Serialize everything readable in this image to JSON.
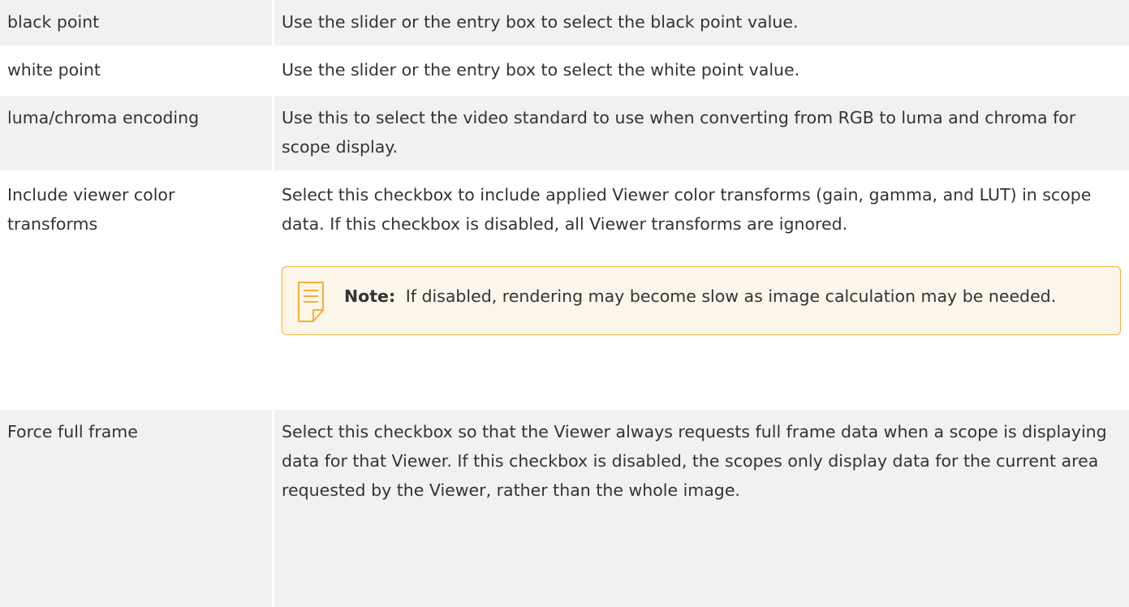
{
  "rows": [
    {
      "label": "black point",
      "description": "Use the slider or the entry box to select the black point value."
    },
    {
      "label": "white point",
      "description": "Use the slider or the entry box to select the white point value."
    },
    {
      "label": "luma/chroma encoding",
      "description": "Use this to select the video standard to use when converting from RGB to luma and chroma for scope display."
    },
    {
      "label": "Include viewer color transforms",
      "description": "Select this checkbox to include applied Viewer color transforms (gain, gamma, and LUT) in scope data. If this checkbox is disabled, all Viewer transforms are ignored.",
      "note": {
        "title": "Note:",
        "text": "If disabled, rendering may become slow as image calculation may be needed.",
        "icon": "note-icon"
      }
    },
    {
      "label": "Force full frame",
      "description": "Select this checkbox so that the Viewer always requests full frame data when a scope is displaying data for that Viewer. If this checkbox is disabled, the scopes only display data for the current area requested by the Viewer, rather than the whole image."
    }
  ],
  "colors": {
    "row_shaded": "#f1f1f1",
    "note_border": "#f0b23a",
    "note_background": "#fbf5ea",
    "text": "#333333"
  }
}
